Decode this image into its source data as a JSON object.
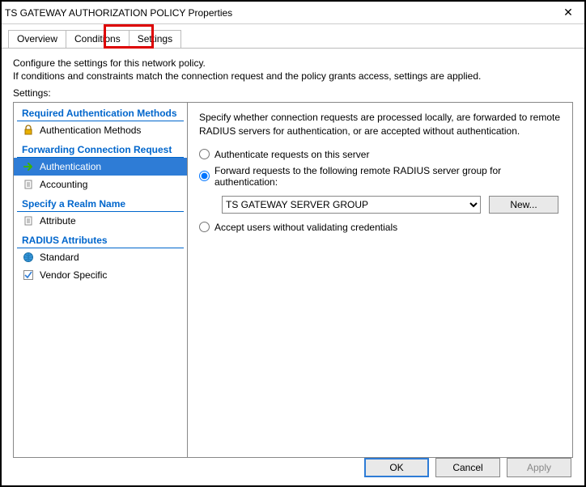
{
  "window": {
    "title": "TS GATEWAY AUTHORIZATION POLICY Properties",
    "close": "✕"
  },
  "tabs": {
    "overview": "Overview",
    "conditions": "Conditions",
    "settings": "Settings"
  },
  "desc": {
    "line1": "Configure the settings for this network policy.",
    "line2": "If conditions and constraints match the connection request and the policy grants access, settings are applied."
  },
  "settings_label": "Settings:",
  "sidebar": {
    "sec1": "Required Authentication Methods",
    "item_auth_methods": "Authentication Methods",
    "sec2": "Forwarding Connection Request",
    "item_authentication": "Authentication",
    "item_accounting": "Accounting",
    "sec3": "Specify a Realm Name",
    "item_attribute": "Attribute",
    "sec4": "RADIUS Attributes",
    "item_standard": "Standard",
    "item_vendor": "Vendor Specific"
  },
  "content": {
    "para": "Specify whether connection requests are processed locally, are forwarded to remote RADIUS servers for authentication, or are accepted without authentication.",
    "radio_local": "Authenticate requests on this server",
    "radio_forward": "Forward requests to the following remote RADIUS server group for authentication:",
    "radius_group": "TS GATEWAY SERVER GROUP",
    "new_btn": "New...",
    "radio_accept": "Accept users without validating credentials"
  },
  "buttons": {
    "ok": "OK",
    "cancel": "Cancel",
    "apply": "Apply"
  }
}
